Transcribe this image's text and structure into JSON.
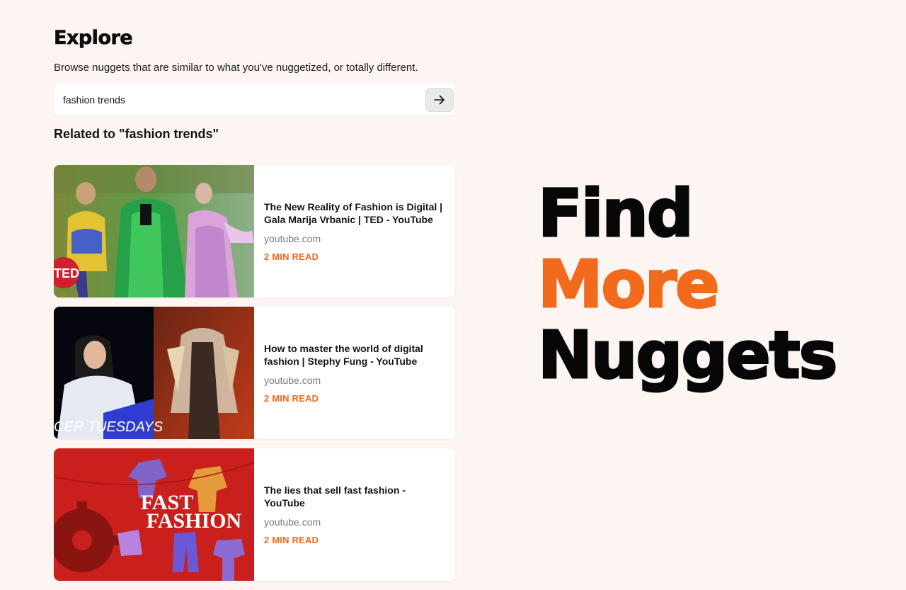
{
  "explore": {
    "title": "Explore",
    "subtitle": "Browse nuggets that are similar to what you've nuggetized, or totally different."
  },
  "search": {
    "value": "fashion trends",
    "button_icon": "arrow-right-icon"
  },
  "related": {
    "heading": "Related to \"fashion trends\""
  },
  "cards": [
    {
      "title": "The New Reality of Fashion is Digital | Gala Marija Vrbanic | TED - YouTube",
      "source": "youtube.com",
      "read_time": "2 MIN READ",
      "thumb_text": "TED"
    },
    {
      "title": "How to master the world of digital fashion | Stephy Fung - YouTube",
      "source": "youtube.com",
      "read_time": "2 MIN READ",
      "thumb_text": "CER TUESDAYS"
    },
    {
      "title": "The lies that sell fast fashion - YouTube",
      "source": "youtube.com",
      "read_time": "2 MIN READ",
      "thumb_text_1": "FAST",
      "thumb_text_2": "FASHION"
    }
  ],
  "hero": {
    "line1": "Find",
    "line2": "More",
    "line3": "Nuggets"
  },
  "colors": {
    "accent": "#f26a1b",
    "background": "#fdf5f1",
    "text": "#0c0c0c"
  }
}
